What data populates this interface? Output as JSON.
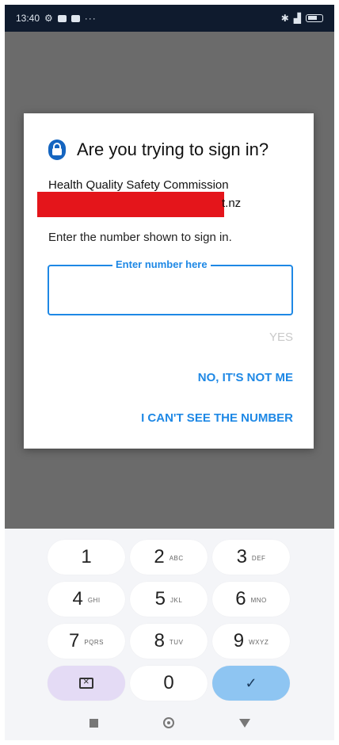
{
  "status_bar": {
    "time": "13:40",
    "more_dots": "···"
  },
  "dialog": {
    "title": "Are you trying to sign in?",
    "organization": "Health Quality Safety Commission",
    "email_visible_suffix": "t.nz",
    "instruction": "Enter the number shown to sign in.",
    "field": {
      "label": "Enter number here",
      "value": "",
      "placeholder": ""
    },
    "actions": {
      "yes": "YES",
      "not_me": "NO, IT'S NOT ME",
      "cant_see": "I CAN'T SEE THE NUMBER"
    }
  },
  "keypad": {
    "keys": [
      {
        "digit": "1",
        "letters": ""
      },
      {
        "digit": "2",
        "letters": "ABC"
      },
      {
        "digit": "3",
        "letters": "DEF"
      },
      {
        "digit": "4",
        "letters": "GHI"
      },
      {
        "digit": "5",
        "letters": "JKL"
      },
      {
        "digit": "6",
        "letters": "MNO"
      },
      {
        "digit": "7",
        "letters": "PQRS"
      },
      {
        "digit": "8",
        "letters": "TUV"
      },
      {
        "digit": "9",
        "letters": "WXYZ"
      }
    ],
    "zero": "0",
    "ok_symbol": "✓"
  },
  "colors": {
    "accent": "#1e88e5",
    "redaction": "#e4151b",
    "status_bar_bg": "#0f1b2e"
  }
}
